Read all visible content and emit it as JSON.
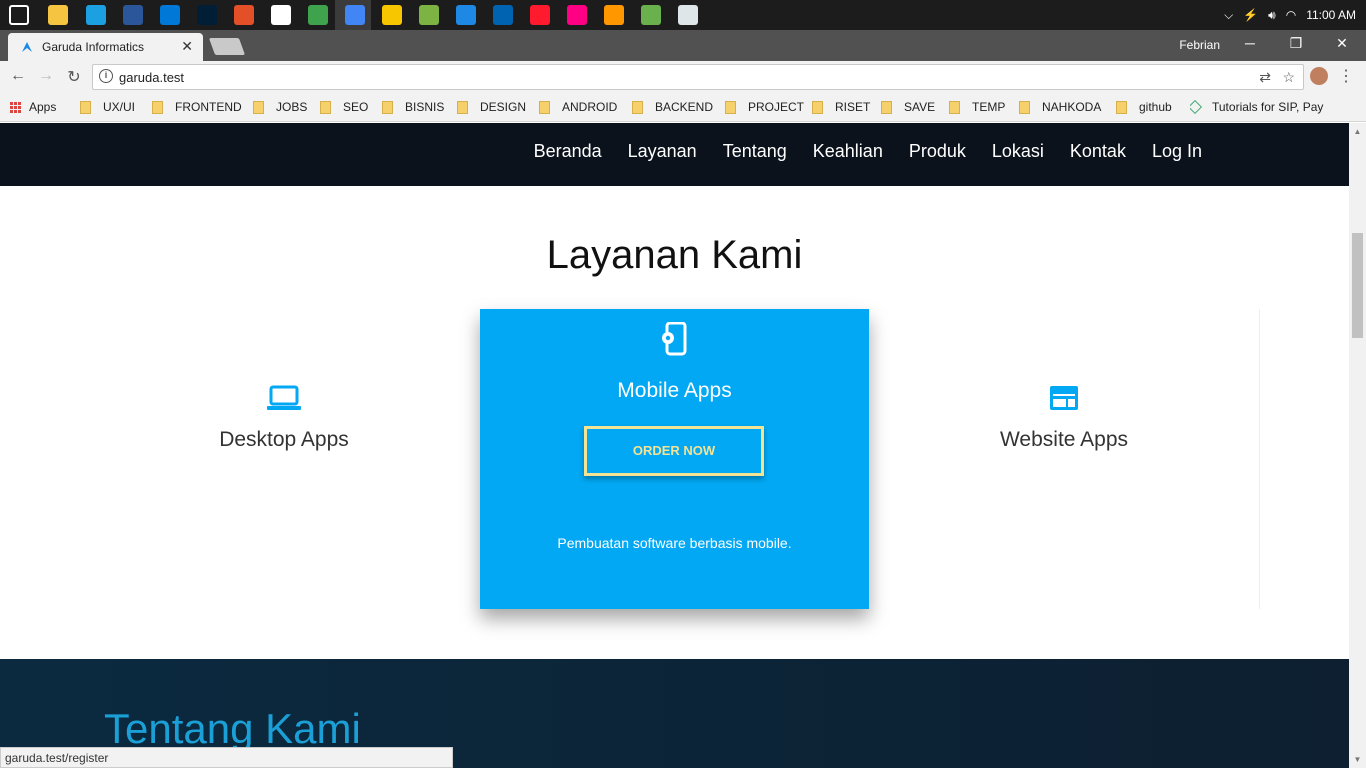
{
  "taskbar": {
    "time": "11:00 AM",
    "icons": [
      "windows-start-icon",
      "file-explorer-icon",
      "search-app-icon",
      "word-icon",
      "outlook-icon",
      "photoshop-icon",
      "paint-icon",
      "obs-icon",
      "sketch-icon",
      "chrome-icon",
      "notes-icon",
      "lambda-icon",
      "browser-icon",
      "remote-icon",
      "opera-icon",
      "flickr-icon",
      "sublime-icon",
      "hs-icon",
      "window-icon"
    ]
  },
  "browser": {
    "tab_title": "Garuda Informatics",
    "user": "Febrian",
    "url": "garuda.test",
    "bookmarks": [
      "Apps",
      "UX/UI",
      "FRONTEND",
      "JOBS",
      "SEO",
      "BISNIS",
      "DESIGN",
      "ANDROID",
      "BACKEND",
      "PROJECT",
      "RISET",
      "SAVE",
      "TEMP",
      "NAHKODA",
      "github",
      "Tutorials for SIP, Pay"
    ]
  },
  "site": {
    "nav": [
      "Beranda",
      "Layanan",
      "Tentang",
      "Keahlian",
      "Produk",
      "Lokasi",
      "Kontak",
      "Log In"
    ],
    "services_heading": "Layanan Kami",
    "services": {
      "desktop": "Desktop Apps",
      "mobile": "Mobile Apps",
      "website": "Website Apps"
    },
    "order_label": "ORDER NOW",
    "mobile_desc": "Pembuatan software berbasis mobile.",
    "about_heading": "Tentang Kami",
    "accent_color": "#02a8f3"
  },
  "status_url": "garuda.test/register"
}
